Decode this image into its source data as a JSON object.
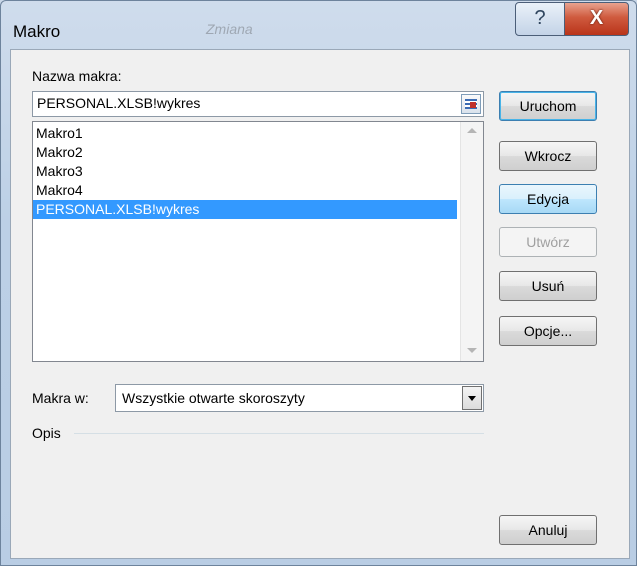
{
  "window": {
    "title": "Makro",
    "ghost_text": "Zmiana"
  },
  "titlebar": {
    "help_glyph": "?",
    "close_glyph": "X"
  },
  "form": {
    "name_label": "Nazwa makra:",
    "name_value": "PERSONAL.XLSB!wykres",
    "macros": [
      "Makro1",
      "Makro2",
      "Makro3",
      "Makro4",
      "PERSONAL.XLSB!wykres"
    ],
    "selected_macro": "PERSONAL.XLSB!wykres",
    "macros_in_label": "Makra w:",
    "macros_in_value": "Wszystkie otwarte skoroszyty",
    "description_label": "Opis"
  },
  "buttons": {
    "run": "Uruchom",
    "step": "Wkrocz",
    "edit": "Edycja",
    "create": "Utwórz",
    "delete": "Usuń",
    "options": "Opcje...",
    "cancel": "Anuluj"
  },
  "icons": {
    "help": "help-icon",
    "close": "close-icon",
    "picker": "range-picker-icon",
    "dropdown": "chevron-down-icon"
  }
}
